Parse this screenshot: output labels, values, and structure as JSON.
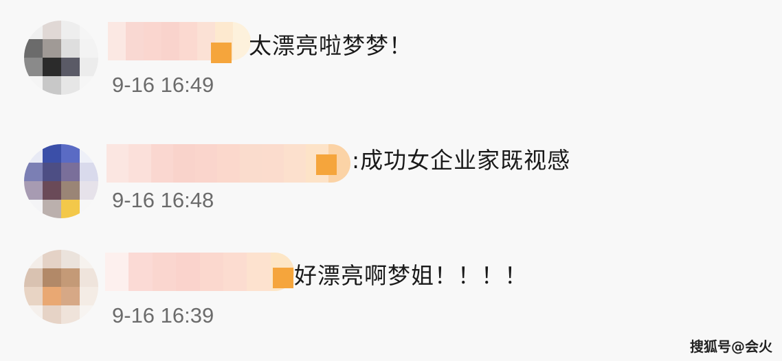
{
  "comments": [
    {
      "text": "太漂亮啦梦梦！",
      "time": "9-16 16:49",
      "avatar_colors": [
        "#f0f0f0",
        "#e0d8d5",
        "#eeeeee",
        "#f5f5f5",
        "#6b6b6b",
        "#a09a96",
        "#dedede",
        "#f3f3f3",
        "#8a8a8a",
        "#2b2b2b",
        "#5a5a66",
        "#ececec",
        "#f5f5f5",
        "#c8c8c8",
        "#e6e6e6",
        "#f6f6f6"
      ],
      "name_colors": [
        "#fbe8e3",
        "#f9d8d2",
        "#fad6cf",
        "#f9d3cc",
        "#fbd9d0",
        "#fbe1d5",
        "#fde9cf",
        "#fdf1dc"
      ]
    },
    {
      "text": ":成功女企业家既视感",
      "time": "9-16 16:48",
      "avatar_colors": [
        "#e8eaf5",
        "#3b4fa8",
        "#5a6bc4",
        "#eef0f8",
        "#7b7fb4",
        "#4d4e84",
        "#7a6f9a",
        "#d9daec",
        "#a79bb2",
        "#6a4a58",
        "#9a8576",
        "#e6e2ea",
        "#f4f4f6",
        "#bbb0ad",
        "#f3c84a",
        "#f7f7f7"
      ],
      "name_colors": [
        "#fbe6e1",
        "#fbe0da",
        "#fad7d0",
        "#f9d3cb",
        "#fad5cc",
        "#fbd8cc",
        "#fadccd",
        "#fbdccd",
        "#fce0cd",
        "#fde3c8",
        "#fbd3a6"
      ]
    },
    {
      "text": "好漂亮啊梦姐！！！！",
      "time": "9-16 16:39",
      "avatar_colors": [
        "#f3ede8",
        "#e4d2c6",
        "#ebe3dc",
        "#f6f2ee",
        "#d9c2b1",
        "#b28968",
        "#c49a77",
        "#efe4dc",
        "#e8d4c4",
        "#e9a873",
        "#d6a886",
        "#f4ece5",
        "#f5f0ec",
        "#e6d3c6",
        "#efe3da",
        "#f7f4f1"
      ],
      "name_colors": [
        "#fdf0ee",
        "#fbdad5",
        "#fad6cf",
        "#fad3cc",
        "#fbd8ce",
        "#fcdcd0",
        "#fde2cf",
        "#fde6c6"
      ]
    }
  ],
  "watermark": "搜狐号@会火"
}
